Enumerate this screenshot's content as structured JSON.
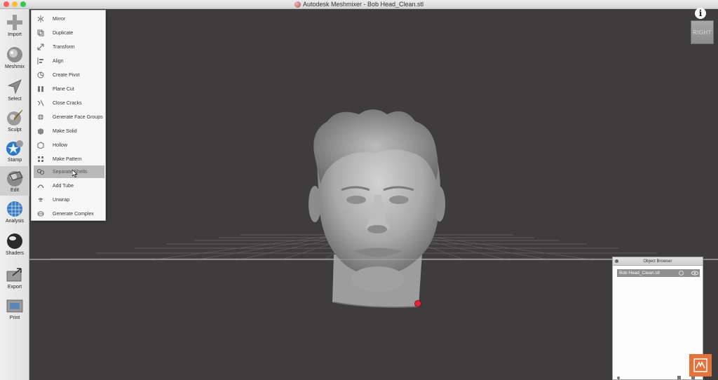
{
  "window": {
    "title": "Autodesk Meshmixer - Bob Head_Clean.stl"
  },
  "toolbar": {
    "tools": [
      {
        "label": "Import",
        "icon": "import-icon"
      },
      {
        "label": "Meshmix",
        "icon": "meshmix-icon"
      },
      {
        "label": "Select",
        "icon": "select-icon"
      },
      {
        "label": "Sculpt",
        "icon": "sculpt-icon"
      },
      {
        "label": "Stamp",
        "icon": "stamp-icon"
      },
      {
        "label": "Edit",
        "icon": "edit-icon"
      },
      {
        "label": "Analysis",
        "icon": "analysis-icon"
      },
      {
        "label": "Shaders",
        "icon": "shaders-icon"
      },
      {
        "label": "Export",
        "icon": "export-icon"
      },
      {
        "label": "Print",
        "icon": "print-icon"
      }
    ],
    "active": "Edit"
  },
  "edit_menu": {
    "items": [
      {
        "label": "Mirror"
      },
      {
        "label": "Duplicate"
      },
      {
        "label": "Transform"
      },
      {
        "label": "Align"
      },
      {
        "label": "Create Pivot"
      },
      {
        "label": "Plane Cut"
      },
      {
        "label": "Close Cracks"
      },
      {
        "label": "Generate Face Groups"
      },
      {
        "label": "Make Solid"
      },
      {
        "label": "Hollow"
      },
      {
        "label": "Make Pattern"
      },
      {
        "label": "Separate Shells"
      },
      {
        "label": "Add Tube"
      },
      {
        "label": "Unwrap"
      },
      {
        "label": "Generate Complex"
      }
    ],
    "hovered": "Separate Shells"
  },
  "view_cube": {
    "label": "RIGHT"
  },
  "info": {
    "glyph": "i"
  },
  "object_browser": {
    "title": "Object Browser",
    "objects": [
      {
        "name": "Bob Head_Clean.stl"
      }
    ]
  },
  "colors": {
    "background": "#3c3a3a",
    "toolbar": "#e8e8e8",
    "menu_hover": "#b9b9b9",
    "pivot": "#e0243a",
    "brand": "#e5723a"
  }
}
